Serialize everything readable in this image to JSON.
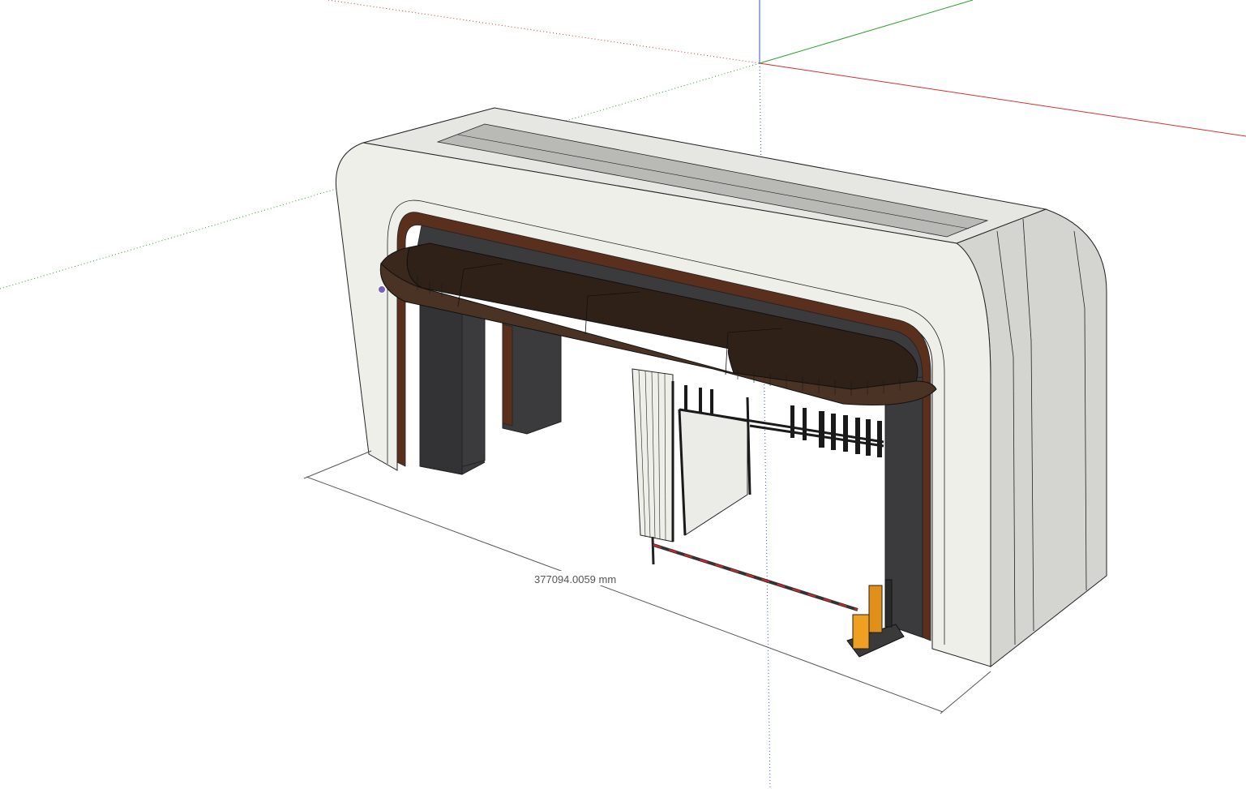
{
  "viewport": {
    "background": "#ffffff",
    "axes": {
      "red": "#d03030",
      "green": "#2e9e2e",
      "blue": "#3050d0"
    }
  },
  "model": {
    "colors": {
      "frame_front": "#efefea",
      "frame_side": "#d4d4d0",
      "frame_top": "#c8c8c4",
      "roof_inset": "#b9b9b6",
      "inner_trim": "#5a2f1e",
      "inner_dark": "#3b3b3d",
      "canopy": "#2f2118",
      "canopy_edge": "#4a3325",
      "barrier_body": "#f0a020",
      "edge_line": "#222222"
    }
  },
  "dimension": {
    "label": "377094.0059 mm"
  },
  "vertex_marker_color": "#7a5fc0"
}
